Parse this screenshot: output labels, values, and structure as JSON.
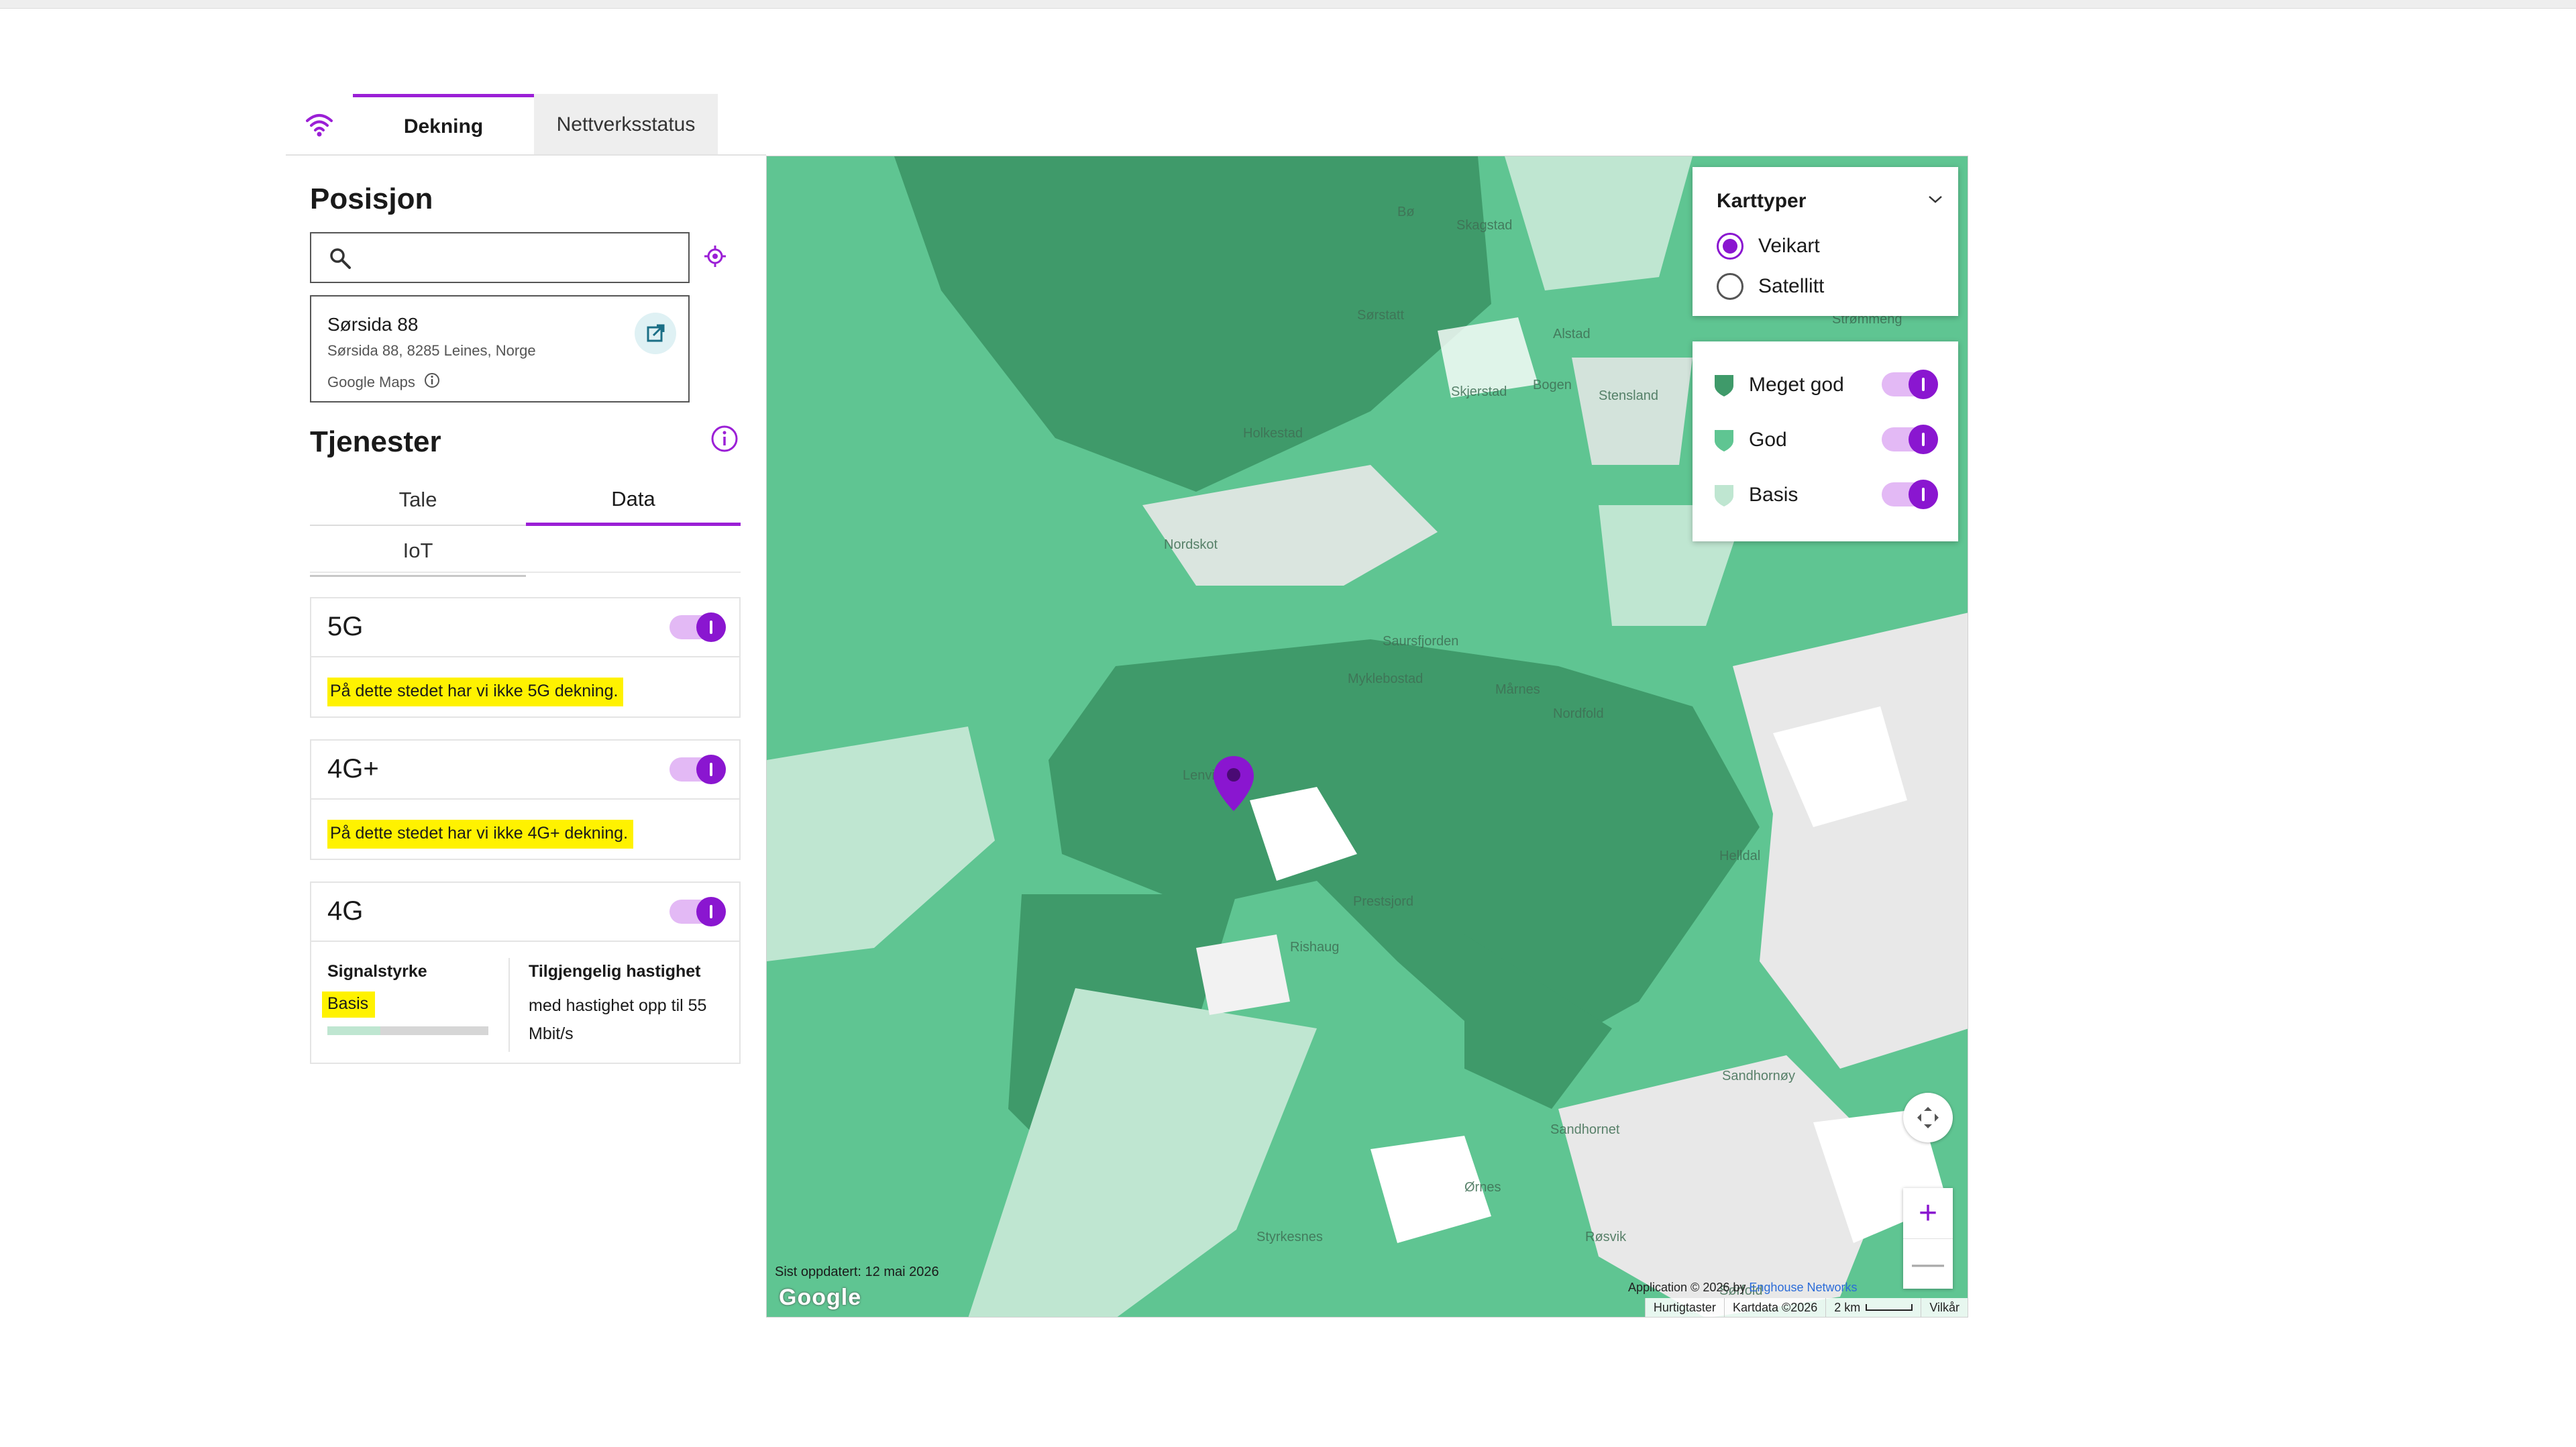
{
  "tabs": {
    "dekning": "Dekning",
    "nettverksstatus": "Nettverksstatus"
  },
  "position": {
    "heading": "Posisjon",
    "search_placeholder": "",
    "result": {
      "title": "Sørsida 88",
      "address": "Sørsida 88, 8285 Leines, Norge",
      "source": "Google Maps"
    }
  },
  "services": {
    "heading": "Tjenester",
    "tabs": {
      "tale": "Tale",
      "data": "Data",
      "iot": "IoT"
    },
    "networks": [
      {
        "name": "5G",
        "message": "På dette stedet har vi ikke 5G dekning.",
        "enabled": true
      },
      {
        "name": "4G+",
        "message": "På dette stedet har vi ikke 4G+ dekning.",
        "enabled": true
      },
      {
        "name": "4G",
        "enabled": true,
        "signal_label": "Signalstyrke",
        "signal_value": "Basis",
        "signal_level": 0.33,
        "speed_label": "Tilgjengelig hastighet",
        "speed_value": "med hastighet opp til 55 Mbit/s"
      }
    ]
  },
  "map": {
    "types_title": "Karttyper",
    "types": [
      {
        "label": "Veikart",
        "selected": true
      },
      {
        "label": "Satellitt",
        "selected": false
      }
    ],
    "legend": [
      {
        "label": "Meget god",
        "color": "#3f9a6a",
        "enabled": true
      },
      {
        "label": "God",
        "color": "#5fc592",
        "enabled": true
      },
      {
        "label": "Basis",
        "color": "#bfe6d1",
        "enabled": true
      }
    ],
    "place_labels": [
      "Bø",
      "Skagstad",
      "Sørstatt",
      "Alstad",
      "Bogen",
      "Stensland",
      "Strømmeng",
      "Holkestad",
      "Skjerstad",
      "Nordskot",
      "Saursfjorden",
      "Myklebostad",
      "Mårnes",
      "Nordfold",
      "Helldal",
      "Sandhornøy",
      "Sandhornet",
      "Ørnes",
      "Sørfold",
      "Styrkesnes",
      "Prestsjord",
      "Rishaug",
      "Røsvik",
      "Lenvik"
    ],
    "updated": "Sist oppdatert: 12 mai 2026",
    "google": "Google",
    "attribution_prefix": "Application © 2026 by",
    "attribution_link": "Enghouse Networks",
    "footer": {
      "shortcuts": "Hurtigtaster",
      "mapdata": "Kartdata ©2026",
      "scale": "2 km",
      "terms": "Vilkår"
    },
    "zoom_in": "+",
    "zoom_out": "—",
    "colors": {
      "very_good": "#3f9a6a",
      "good": "#5fc592",
      "basic": "#bfe6d1",
      "land": "#e8e8e8"
    }
  },
  "accent": "#8a16d0"
}
